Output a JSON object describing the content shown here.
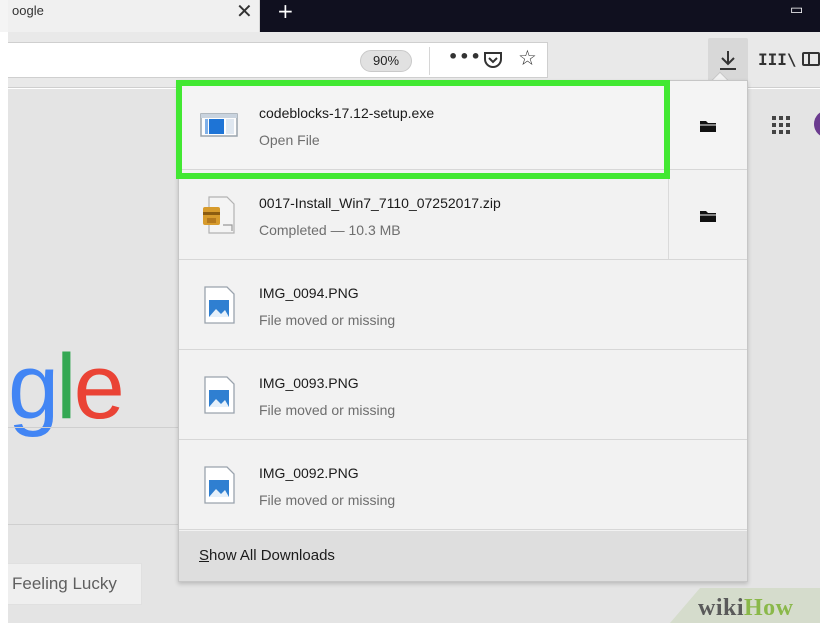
{
  "browser": {
    "tab_title": "oogle",
    "tab_close": "✕",
    "new_tab": "+",
    "zoom": "90%",
    "more_label": "•••"
  },
  "page": {
    "logo_g": "g",
    "logo_l": "l",
    "logo_e": "e",
    "lucky_button": "Feeling Lucky"
  },
  "downloads": {
    "items": [
      {
        "name": "codeblocks-17.12-setup.exe",
        "status": "Open File",
        "icon": "exe-file-icon",
        "has_folder": true
      },
      {
        "name": "0017-Install_Win7_7110_07252017.zip",
        "status": "Completed — 10.3 MB",
        "icon": "zip-archive-icon",
        "has_folder": true
      },
      {
        "name": "IMG_0094.PNG",
        "status": "File moved or missing",
        "icon": "image-file-icon",
        "has_folder": false
      },
      {
        "name": "IMG_0093.PNG",
        "status": "File moved or missing",
        "icon": "image-file-icon",
        "has_folder": false
      },
      {
        "name": "IMG_0092.PNG",
        "status": "File moved or missing",
        "icon": "image-file-icon",
        "has_folder": false
      }
    ],
    "show_all_underlined": "S",
    "show_all_rest": "how All Downloads"
  },
  "watermark": {
    "wiki": "wiki",
    "how": "How"
  },
  "colors": {
    "highlight": "#42e832",
    "google_blue": "#4285f4",
    "google_green": "#34a853",
    "google_red": "#ea4335"
  }
}
